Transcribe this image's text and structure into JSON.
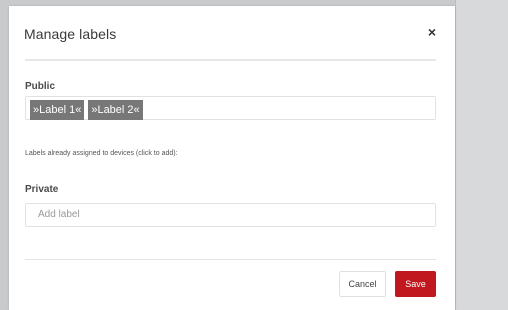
{
  "dialog": {
    "title": "Manage labels",
    "close_glyph": "×"
  },
  "public": {
    "label": "Public",
    "tags": [
      "»Label 1«",
      "»Label 2«"
    ],
    "helper_text": "Labels already assigned to devices (click to add):"
  },
  "private": {
    "label": "Private",
    "placeholder": "Add label"
  },
  "footer": {
    "cancel_label": "Cancel",
    "save_label": "Save"
  },
  "colors": {
    "save_button": "#c0181e",
    "tag_background": "#777777",
    "backdrop": "#c9cacb"
  },
  "icons": {
    "close": "close-icon"
  }
}
